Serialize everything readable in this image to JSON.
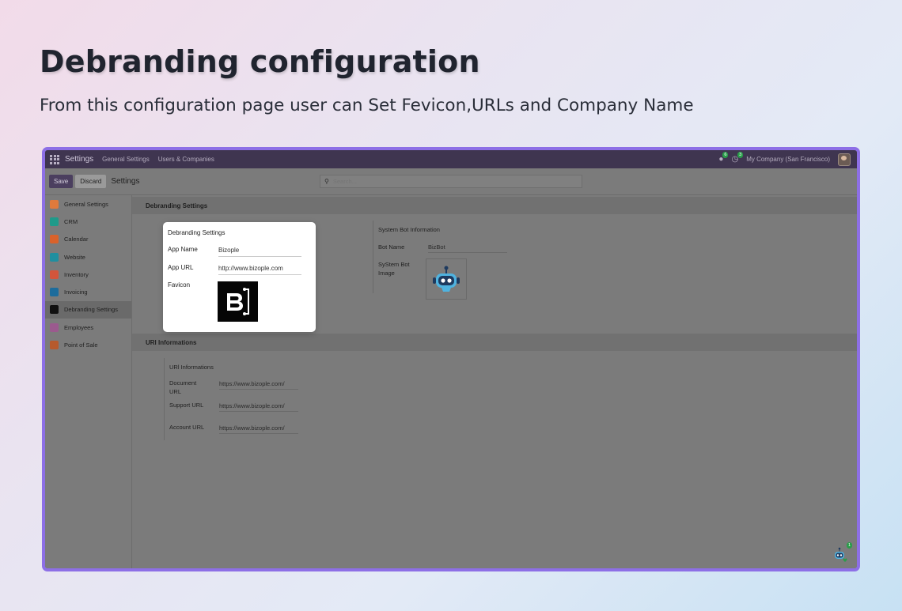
{
  "hero": {
    "title": "Debranding configuration",
    "subtitle": "From this configuration page user can Set Fevicon,URLs and Company Name"
  },
  "navbar": {
    "brand": "Settings",
    "links": [
      "General Settings",
      "Users & Companies"
    ],
    "chat_badge": "6",
    "activity_badge": "3",
    "company": "My Company (San Francisco)"
  },
  "control": {
    "save_label": "Save",
    "discard_label": "Discard",
    "breadcrumb": "Settings",
    "search_placeholder": "Search..."
  },
  "sidebar": {
    "items": [
      {
        "label": "General Settings",
        "icon": "settings-icon",
        "color": "#e07a3c"
      },
      {
        "label": "CRM",
        "icon": "crm-icon",
        "color": "#1f9a8a"
      },
      {
        "label": "Calendar",
        "icon": "calendar-icon",
        "color": "#d9622b"
      },
      {
        "label": "Website",
        "icon": "website-icon",
        "color": "#1f8fa0"
      },
      {
        "label": "Inventory",
        "icon": "inventory-icon",
        "color": "#d2553b"
      },
      {
        "label": "Invoicing",
        "icon": "invoicing-icon",
        "color": "#1d6c9c"
      },
      {
        "label": "Debranding Settings",
        "icon": "debranding-icon",
        "color": "#111111"
      },
      {
        "label": "Employees",
        "icon": "employees-icon",
        "color": "#9b5a8e"
      },
      {
        "label": "Point of Sale",
        "icon": "point-of-sale-icon",
        "color": "#b65a2d"
      }
    ],
    "active_index": 6
  },
  "debranding": {
    "section_title": "Debranding Settings",
    "popup": {
      "title": "Debranding Settings",
      "app_name_label": "App Name",
      "app_name_value": "Bizople",
      "app_url_label": "App URL",
      "app_url_value": "http://www.bizople.com",
      "favicon_label": "Favicon"
    },
    "bot": {
      "title": "System Bot Information",
      "name_label": "Bot Name",
      "name_value": "BizBot",
      "image_label": "SyStem Bot Image"
    }
  },
  "urls": {
    "section_title": "URl Informations",
    "subtitle": "URl Informations",
    "rows": [
      {
        "label": "Document URL",
        "value": "https://www.bizople.com/"
      },
      {
        "label": "Support URL",
        "value": "https://www.bizople.com/"
      },
      {
        "label": "Account URL",
        "value": "https://www.bizople.com/"
      }
    ]
  },
  "chatbot_badge": "1",
  "colors": {
    "frame_border": "#8d6fe6",
    "navbar": "#3f3550",
    "overlay": "#7b7b7b"
  }
}
